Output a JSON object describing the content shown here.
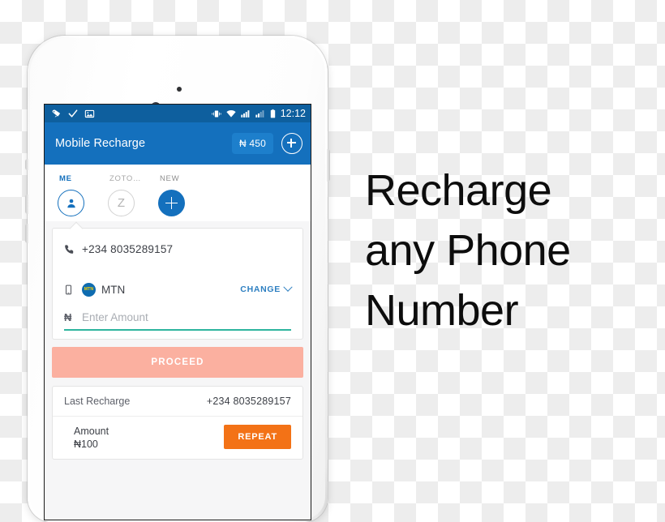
{
  "promo": {
    "line1": "Recharge",
    "line2": "any Phone",
    "line3": "Number"
  },
  "statusbar": {
    "icons_left": [
      "tag-icon",
      "checkmark-icon",
      "image-icon"
    ],
    "icons_right": [
      "vibrate-icon",
      "wifi-icon",
      "signal-sim1-icon",
      "signal-sim2-icon",
      "battery-icon"
    ],
    "time": "12:12"
  },
  "appbar": {
    "title": "Mobile Recharge",
    "balance": "₦ 450",
    "add_icon": "plus-circle-icon"
  },
  "contacts": [
    {
      "label": "ME",
      "avatar_type": "person-icon",
      "selected": true
    },
    {
      "label": "ZOTO…",
      "avatar_type": "Z",
      "selected": false
    },
    {
      "label": "NEW",
      "avatar_type": "plus-icon",
      "selected": false
    }
  ],
  "recharge_form": {
    "phone_icon": "phone-handset-icon",
    "phone_number": "+234 8035289157",
    "device_icon": "mobile-device-icon",
    "carrier_logo_text": "MTN",
    "carrier_name": "MTN",
    "change_label": "CHANGE",
    "change_chevron": "chevron-down-icon",
    "amount_currency": "₦",
    "amount_value": "",
    "amount_placeholder": "Enter Amount",
    "proceed_label": "PROCEED"
  },
  "last_recharge": {
    "title": "Last Recharge",
    "number": "+234 8035289157",
    "amount_label": "Amount",
    "amount_value": "₦100",
    "repeat_label": "REPEAT"
  },
  "colors": {
    "appbar_blue": "#1470bd",
    "statusbar_blue": "#0e5f9e",
    "accent_teal": "#2eb49e",
    "proceed_disabled": "#fbb0a0",
    "repeat_orange": "#f37216"
  }
}
